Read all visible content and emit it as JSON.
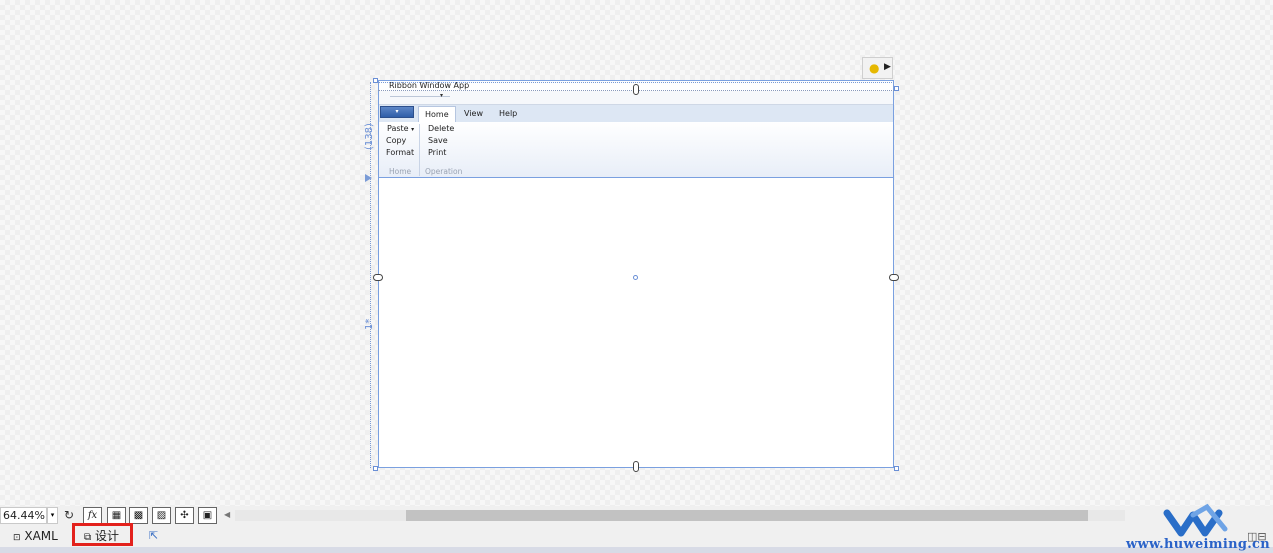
{
  "designer": {
    "window_title": "Ribbon Window App",
    "app_menu_arrow": "▾",
    "qat_arrow": "▾",
    "tabs": [
      "Home",
      "View",
      "Help"
    ],
    "groups": {
      "home": {
        "items": [
          "Paste",
          "Copy",
          "Format"
        ],
        "caption": "Home",
        "paste_arrow": "▾"
      },
      "operation": {
        "items": [
          "Delete",
          "Save",
          "Print"
        ],
        "caption": "Operation"
      }
    },
    "row1_height_label": "(138)",
    "row2_height_label": "1*"
  },
  "toolbar": {
    "zoom": "64.44%",
    "zoom_arrow": "▾",
    "refresh_icon": "↻",
    "fx_label": "fx",
    "scroll_left": "◀"
  },
  "view_tabs": {
    "xaml": "XAML",
    "design": "设计"
  },
  "watermark": {
    "text": "www.huweiming.cn",
    "brand_color": "#2a62c8"
  }
}
